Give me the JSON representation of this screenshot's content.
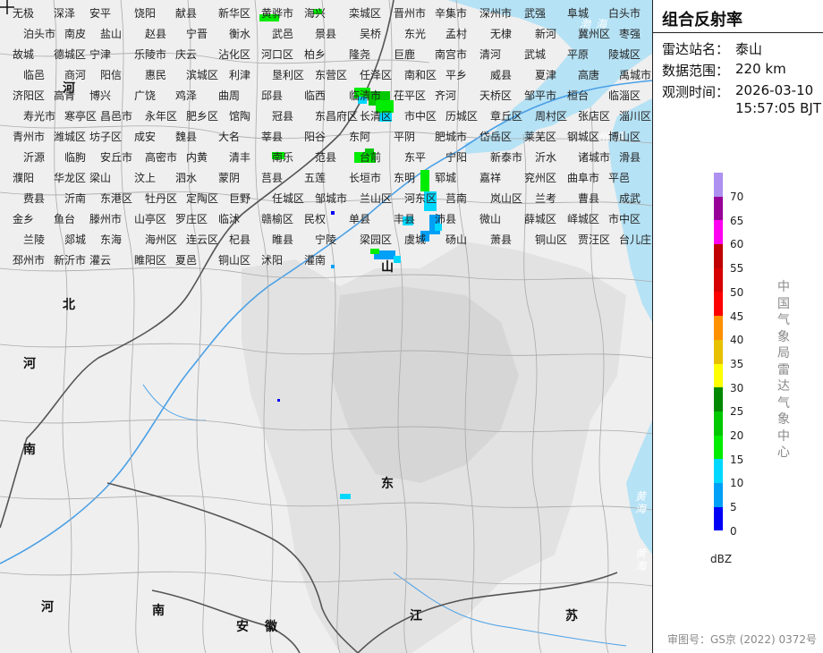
{
  "panel": {
    "title": "组合反射率",
    "station_label": "雷达站名：",
    "station": "泰山",
    "range_label": "数据范围：",
    "range": "220 km",
    "time_label": "观测时间：",
    "date": "2026-03-10",
    "time": "15:57:05 BJT",
    "unit": "dBZ",
    "agency": "中国气象局雷达气象中心",
    "review": "审图号：GS京 (2022) 0372号"
  },
  "legend": {
    "ticks": [
      "70",
      "65",
      "60",
      "55",
      "50",
      "45",
      "40",
      "35",
      "30",
      "25",
      "20",
      "15",
      "10",
      "5",
      "0"
    ],
    "colors": [
      "#ad90f0",
      "#960096",
      "#ff00f0",
      "#c00000",
      "#d60000",
      "#ff0000",
      "#ff9000",
      "#e7c000",
      "#ffff00",
      "#008800",
      "#00c800",
      "#00ec00",
      "#00d8ff",
      "#00a0f6",
      "#0000f6"
    ]
  },
  "sea_labels": [
    "渤海",
    "莱州湾",
    "黄海",
    "黄海"
  ],
  "region_labels": [
    "河",
    "北",
    "河",
    "南",
    "山",
    "东",
    "江",
    "苏",
    "安",
    "徽",
    "南",
    "河"
  ],
  "places": [
    "无极",
    "深泽",
    "安平",
    "饶阳",
    "献县",
    "新华区",
    "黄骅市",
    "海兴",
    "栾城区",
    "晋州市",
    "辛集市",
    "深州市",
    "武强",
    "阜城",
    "白头市",
    "泊头市",
    "南皮",
    "盐山",
    "赵县",
    "宁晋",
    "衡水",
    "武邑",
    "景县",
    "吴桥",
    "东光",
    "孟村",
    "无棣",
    "新河",
    "冀州区",
    "枣强",
    "故城",
    "德城区",
    "宁津",
    "乐陵市",
    "庆云",
    "沾化区",
    "河口区",
    "柏乡",
    "隆尧",
    "巨鹿",
    "南宫市",
    "清河",
    "武城",
    "平原",
    "陵城区",
    "临邑",
    "商河",
    "阳信",
    "惠民",
    "滨城区",
    "利津",
    "垦利区",
    "东营区",
    "任泽区",
    "南和区",
    "平乡",
    "威县",
    "夏津",
    "高唐",
    "禹城市",
    "济阳区",
    "高青",
    "博兴",
    "广饶",
    "鸡泽",
    "曲周",
    "邱县",
    "临西",
    "临清市",
    "茌平区",
    "齐河",
    "天桥区",
    "邹平市",
    "桓台",
    "临淄区",
    "寿光市",
    "寒亭区",
    "昌邑市",
    "永年区",
    "肥乡区",
    "馆陶",
    "冠县",
    "东昌府区",
    "长清区",
    "市中区",
    "历城区",
    "章丘区",
    "周村区",
    "张店区",
    "淄川区",
    "青州市",
    "潍城区",
    "坊子区",
    "成安",
    "魏县",
    "大名",
    "莘县",
    "阳谷",
    "东阿",
    "平阴",
    "肥城市",
    "岱岳区",
    "莱芜区",
    "钢城区",
    "博山区",
    "沂源",
    "临朐",
    "安丘市",
    "高密市",
    "内黄",
    "清丰",
    "南乐",
    "范县",
    "台前",
    "东平",
    "宁阳",
    "新泰市",
    "沂水",
    "诸城市",
    "滑县",
    "濮阳",
    "华龙区",
    "梁山",
    "汶上",
    "泗水",
    "蒙阴",
    "莒县",
    "五莲",
    "长垣市",
    "东明",
    "郓城",
    "嘉祥",
    "兖州区",
    "曲阜市",
    "平邑",
    "费县",
    "沂南",
    "东港区",
    "牡丹区",
    "定陶区",
    "巨野",
    "任城区",
    "邹城市",
    "兰山区",
    "河东区",
    "莒南",
    "岚山区",
    "兰考",
    "曹县",
    "成武",
    "金乡",
    "鱼台",
    "滕州市",
    "山亭区",
    "罗庄区",
    "临沭",
    "赣榆区",
    "民权",
    "单县",
    "丰县",
    "沛县",
    "微山",
    "薛城区",
    "峄城区",
    "市中区",
    "兰陵",
    "郯城",
    "东海",
    "海州区",
    "连云区",
    "杞县",
    "睢县",
    "宁陵",
    "梁园区",
    "虞城",
    "砀山",
    "萧县",
    "铜山区",
    "贾汪区",
    "台儿庄区",
    "邳州市",
    "新沂市",
    "灌云",
    "睢阳区",
    "夏邑",
    "铜山区",
    "沭阳",
    "灌南"
  ]
}
